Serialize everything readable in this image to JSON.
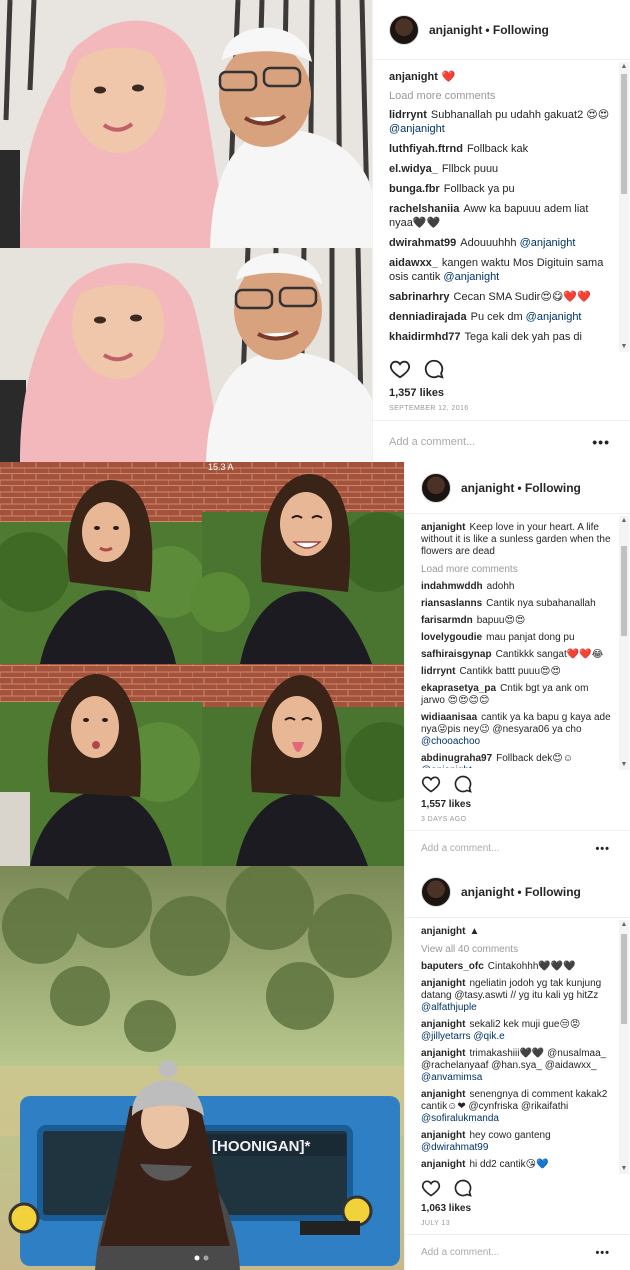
{
  "posts": [
    {
      "username": "anjanight",
      "follow_label": "Following",
      "caption": "❤️",
      "load_more": "Load more comments",
      "comments": [
        {
          "user": "lidrrynt",
          "text": "Subhanallah pu udahh gakuat2 😍😍",
          "mention": "@anjanight"
        },
        {
          "user": "luthfiyah.ftrnd",
          "text": "Follback kak",
          "mention": ""
        },
        {
          "user": "el.widya_",
          "text": "Fllbck puuu",
          "mention": ""
        },
        {
          "user": "bunga.fbr",
          "text": "Follback ya pu",
          "mention": ""
        },
        {
          "user": "rachelshaniia",
          "text": "Aww ka bapuuu adem liat nyaa🖤🖤",
          "mention": ""
        },
        {
          "user": "dwirahmat99",
          "text": "Adouuuhhh",
          "mention": "@anjanight"
        },
        {
          "user": "aidawxx_",
          "text": "kangen waktu Mos Digituin sama osis cantik",
          "mention": "@anjanight"
        },
        {
          "user": "sabrinarhry",
          "text": "Cecan SMA Sudir😍😋❤️❤️",
          "mention": ""
        },
        {
          "user": "denniadirajada",
          "text": "Pu cek dm",
          "mention": "@anjanight"
        },
        {
          "user": "khaidirmhd77",
          "text": "Tega kali dek yah pas di",
          "mention": ""
        }
      ],
      "likes": "1,357 likes",
      "date": "SEPTEMBER 12, 2016",
      "add_comment": "Add a comment...",
      "more": "•••"
    },
    {
      "username": "anjanight",
      "follow_label": "Following",
      "caption": "Keep love in your heart. A life without it is like a sunless garden when the flowers are dead",
      "load_more": "Load more comments",
      "photo_watermark": "15.3 A",
      "comments": [
        {
          "user": "indahmwddh",
          "text": "adohh",
          "mention": ""
        },
        {
          "user": "riansaslanns",
          "text": "Cantik nya subahanallah",
          "mention": ""
        },
        {
          "user": "farisarmdn",
          "text": "bapuu😍😍",
          "mention": ""
        },
        {
          "user": "lovelygoudie",
          "text": "mau panjat dong pu",
          "mention": ""
        },
        {
          "user": "safhiraisgynap",
          "text": "Cantikkk sangat❤️❤️😂",
          "mention": ""
        },
        {
          "user": "lidrrynt",
          "text": "Cantikk battt puuu😍😍",
          "mention": ""
        },
        {
          "user": "ekaprasetya_pa",
          "text": "Cntik bgt ya ank om jarwo 😍😍😊😊",
          "mention": ""
        },
        {
          "user": "widiaanisaa",
          "text": "cantik ya ka bapu g kaya ade nya😜pis ney😉 @nesyara06 ya cho",
          "mention": "@chooachoo"
        },
        {
          "user": "abdinugraha97",
          "text": "Follback dek😊☺",
          "mention": "@anjanight"
        }
      ],
      "likes": "1,557 likes",
      "date": "3 DAYS AGO",
      "add_comment": "Add a comment...",
      "more": "•••"
    },
    {
      "username": "anjanight",
      "follow_label": "Following",
      "caption": "▲",
      "load_more": "View all 40 comments",
      "jeep_banner": "[HOONIGAN]*",
      "comments": [
        {
          "user": "baputers_ofc",
          "text": "Cintakohhh🖤🖤🖤",
          "mention": ""
        },
        {
          "user": "anjanight",
          "text": "ngeliatin jodoh yg tak kunjung datang @tasy.aswti // yg itu kali yg hitZz",
          "mention": "@alfathjuple"
        },
        {
          "user": "anjanight",
          "text": "sekali2 kek muji gue😒😡",
          "mention": "@jillyetarrs @qik.e"
        },
        {
          "user": "anjanight",
          "text": "trimakashiii🖤🖤 @nusalmaa_ @rachelanyaaf @han.sya_ @aidawxx_",
          "mention": "@anvamimsa"
        },
        {
          "user": "anjanight",
          "text": "senengnya di comment kakak2 cantik☺❤ @cynfriska @rikaifathi",
          "mention": "@sofiralukmanda"
        },
        {
          "user": "anjanight",
          "text": "hey cowo ganteng",
          "mention": "@dwirahmat99"
        },
        {
          "user": "anjanight",
          "text": "hi dd2 cantik😘💙",
          "mention": ""
        }
      ],
      "likes": "1,063 likes",
      "date": "JULY 13",
      "add_comment": "Add a comment...",
      "more": "•••"
    }
  ],
  "colors": {
    "mention": "#003569",
    "hijab": "#f2b8bc",
    "white_robe": "#f6f6f6",
    "jeep": "#2f7fc4",
    "sky_hills": "#b9c88e"
  },
  "icons": [
    "heart-icon",
    "comment-icon",
    "more-options-icon",
    "scroll-up-icon",
    "scroll-down-icon"
  ]
}
